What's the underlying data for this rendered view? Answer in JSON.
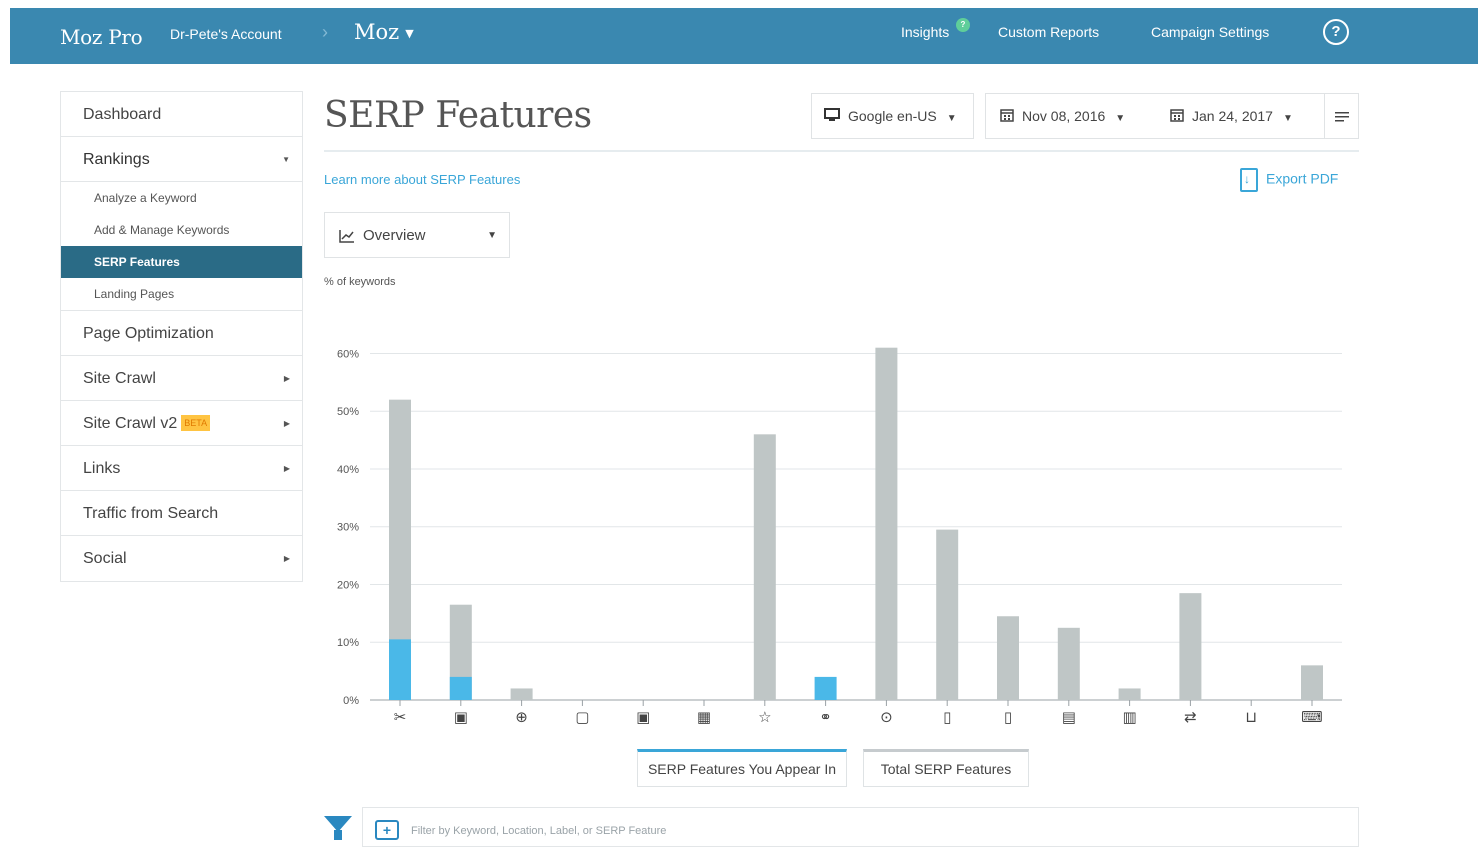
{
  "topbar": {
    "brand": "Moz Pro",
    "account": "Dr-Pete's Account",
    "separator": "›",
    "campaign": "Moz",
    "links": {
      "insights": "Insights",
      "insights_badge": "?",
      "custom_reports": "Custom Reports",
      "campaign_settings": "Campaign Settings"
    },
    "help": "?"
  },
  "sidebar": {
    "items": [
      {
        "label": "Dashboard"
      },
      {
        "label": "Rankings"
      },
      {
        "label": "Page Optimization"
      },
      {
        "label": "Site Crawl"
      },
      {
        "label": "Site Crawl v2",
        "badge": "BETA"
      },
      {
        "label": "Links"
      },
      {
        "label": "Traffic from Search"
      },
      {
        "label": "Social"
      }
    ],
    "rankings_sub": [
      "Analyze a Keyword",
      "Add & Manage Keywords",
      "SERP Features",
      "Landing Pages"
    ]
  },
  "header": {
    "title": "SERP Features",
    "engine": "Google en-US",
    "date_start": "Nov 08, 2016",
    "date_end": "Jan 24, 2017"
  },
  "links": {
    "learn_more": "Learn more about SERP Features",
    "export": "Export PDF"
  },
  "view_select": {
    "value": "Overview"
  },
  "chart_label": "% of keywords",
  "chart_data": {
    "type": "bar",
    "ylabel": "% of keywords",
    "ylim": [
      0,
      60
    ],
    "yticks": [
      "0%",
      "10%",
      "20%",
      "30%",
      "40%",
      "50%",
      "60%"
    ],
    "categories": [
      "featured-snippet-icon",
      "image-pack-icon",
      "knowledge-panel-icon",
      "local-pack-icon",
      "local-teaser-icon",
      "news-icon",
      "reviews-icon",
      "site-links-icon",
      "video-icon",
      "ad-top-icon",
      "ad-bottom-icon",
      "knowledge-card-icon",
      "twitter-icon",
      "related-questions-icon",
      "shopping-icon",
      "people-also-ask-icon"
    ],
    "colors": {
      "total": "#bfc6c6",
      "appear": "#4ab8e8",
      "grid": "#e2e6e8"
    },
    "series": [
      {
        "name": "Total SERP Features",
        "values": [
          52,
          16.5,
          2,
          0,
          0,
          0,
          46,
          0,
          61,
          29.5,
          14.5,
          12.5,
          2,
          18.5,
          0,
          6
        ]
      },
      {
        "name": "SERP Features You Appear In",
        "values": [
          10.5,
          4,
          0,
          0,
          0,
          0,
          0,
          4,
          0,
          0,
          0,
          0,
          0,
          0,
          0,
          0
        ]
      }
    ],
    "icon_glyphs": [
      "✂",
      "▣",
      "⊕",
      "▢",
      "▣",
      "▦",
      "☆",
      "⚭",
      "⊙",
      "▯",
      "▯",
      "▤",
      "▥",
      "⇄",
      "⊔",
      "⌨"
    ]
  },
  "toggles": {
    "appear": "SERP Features You Appear In",
    "total": "Total SERP Features"
  },
  "filter": {
    "placeholder": "Filter by Keyword, Location, Label, or SERP Feature"
  }
}
